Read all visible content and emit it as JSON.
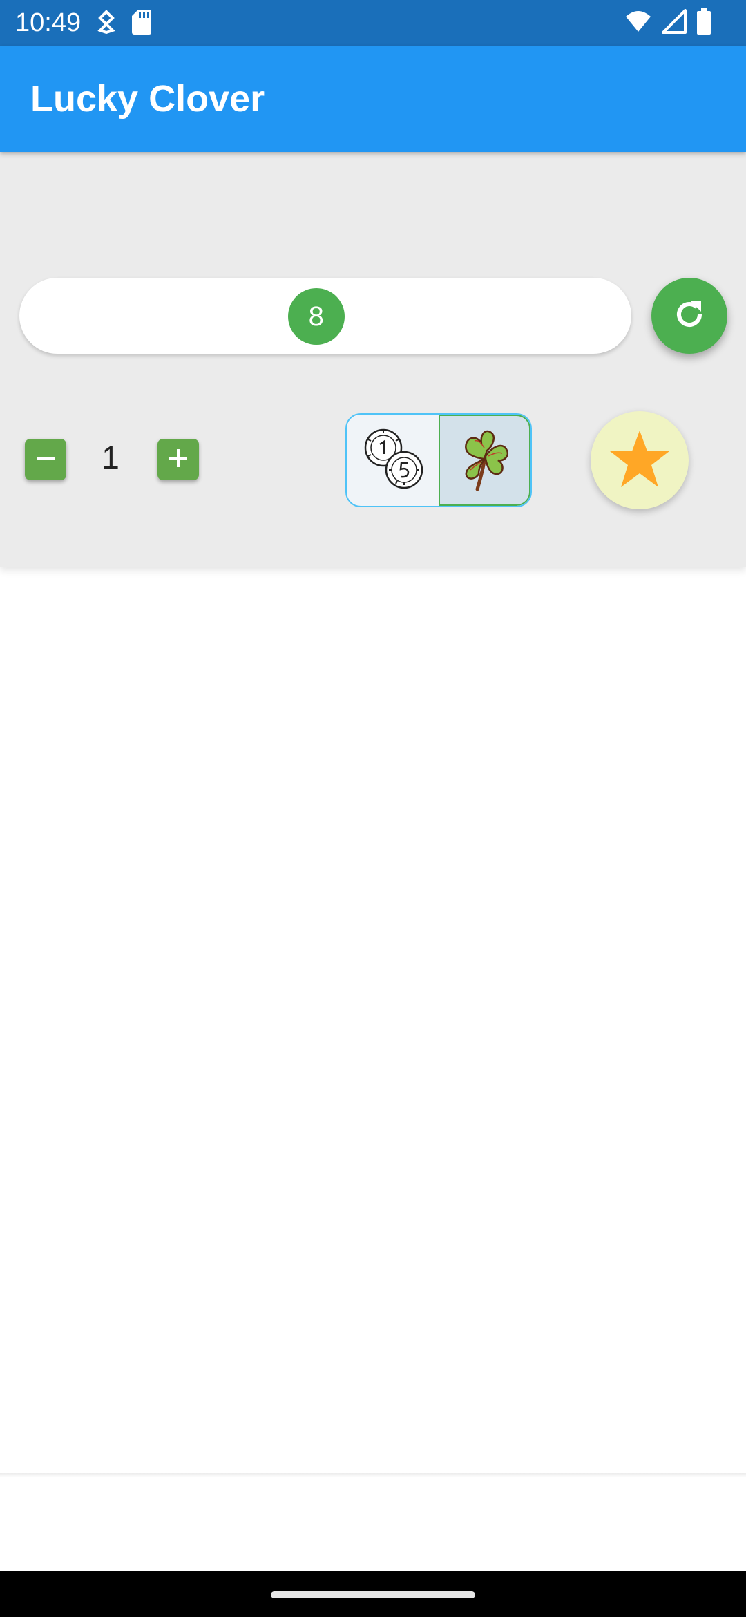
{
  "status_bar": {
    "time": "10:49",
    "left_icons": [
      "usb-debug-icon",
      "sd-card-icon"
    ],
    "right_icons": [
      "wifi-icon",
      "cell-signal-icon",
      "battery-icon"
    ]
  },
  "app_bar": {
    "title": "Lucky Clover"
  },
  "number_slider": {
    "value": "8",
    "position_fraction": 0.485,
    "thumb_color": "#4caf50"
  },
  "refresh_button": {
    "icon": "refresh-icon",
    "color": "#4caf50"
  },
  "count_stepper": {
    "value": "1",
    "decrement_icon": "minus-icon",
    "increment_icon": "plus-icon",
    "color": "#63a84a"
  },
  "mode_toggle": {
    "options": [
      {
        "icon": "lottery-balls-icon",
        "selected": false
      },
      {
        "icon": "four-leaf-clover-icon",
        "selected": true
      }
    ]
  },
  "favorite_button": {
    "icon": "star-icon",
    "star_color": "#ffa726",
    "background": "#f0f4c3"
  },
  "colors": {
    "status_bar": "#1a6fba",
    "app_bar": "#2196f3",
    "panel": "#ebebeb",
    "accent_green": "#4caf50"
  }
}
